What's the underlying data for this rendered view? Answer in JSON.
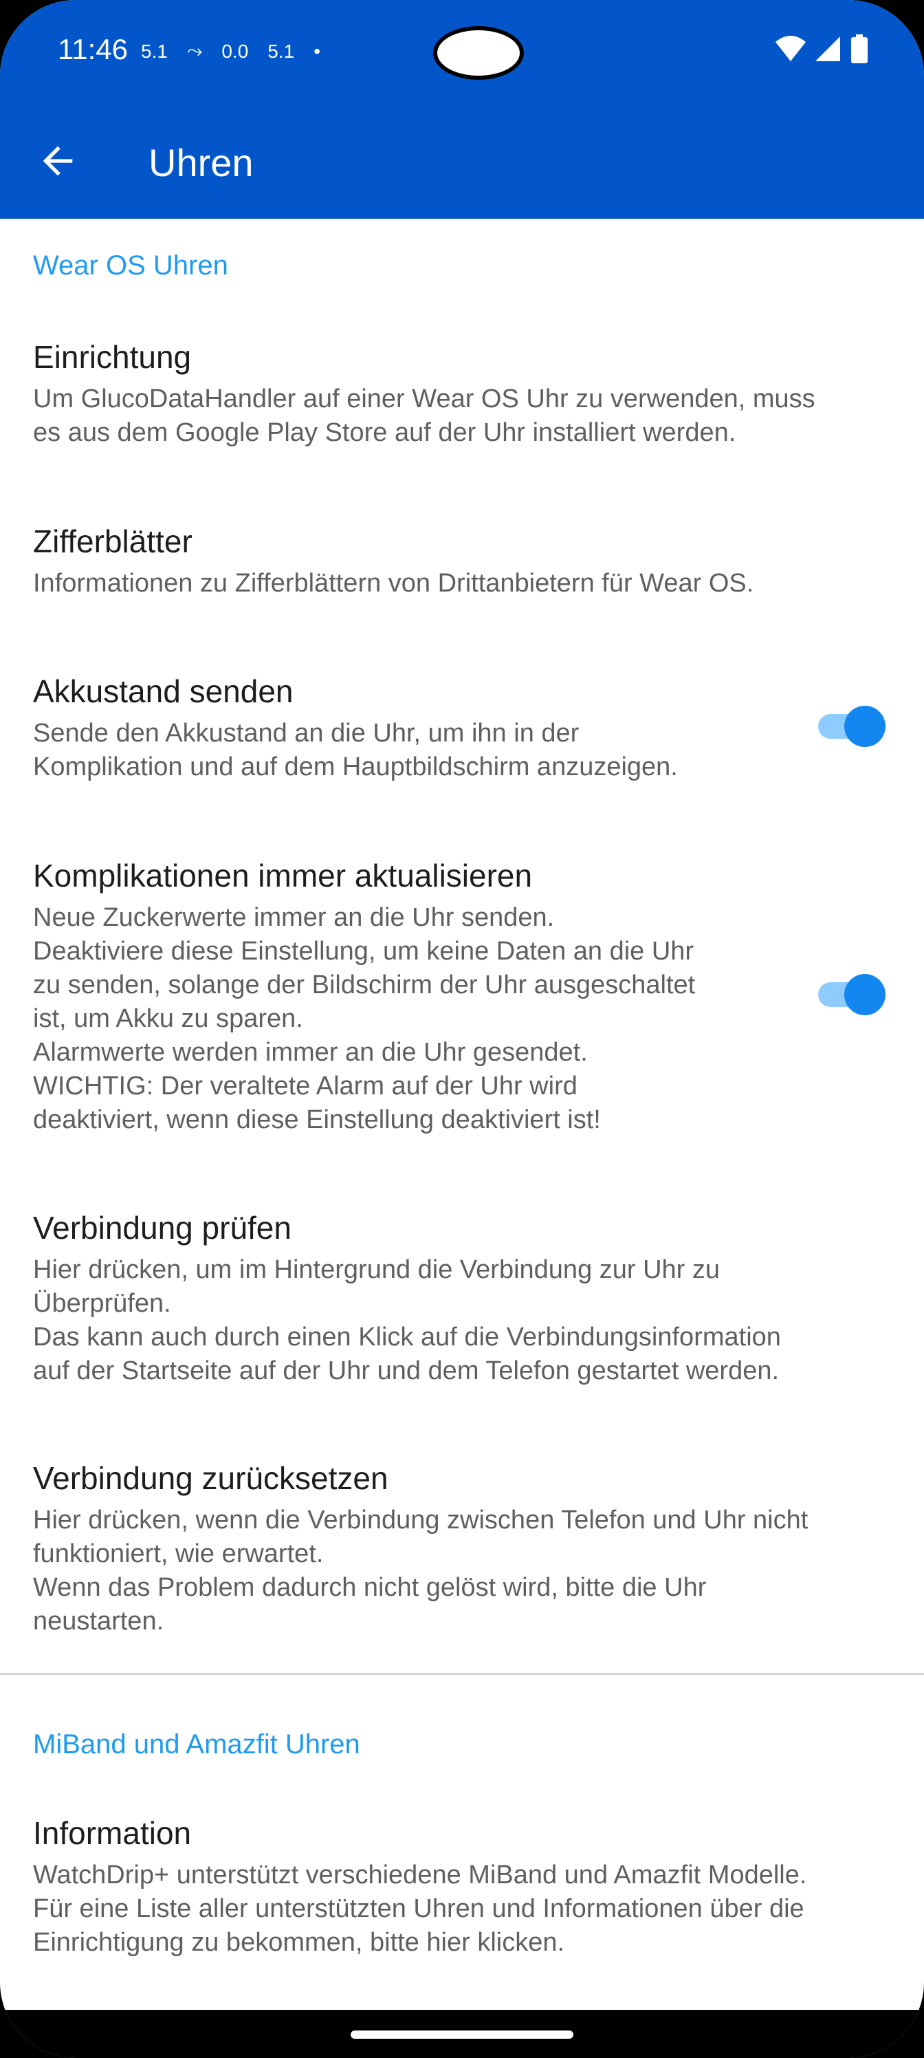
{
  "status_bar": {
    "time": "11:46",
    "indicators": [
      "5.1",
      "⤳",
      "0.0",
      "5.1",
      "•"
    ],
    "icons": [
      "wifi-icon",
      "signal-icon",
      "battery-icon"
    ]
  },
  "app_bar": {
    "title": "Uhren",
    "back_icon": "arrow-back-icon"
  },
  "sections": [
    {
      "header": "Wear OS Uhren",
      "items": [
        {
          "title": "Einrichtung",
          "summary": "Um GlucoDataHandler auf einer Wear OS Uhr zu verwenden, muss\nes aus dem Google Play Store auf der Uhr installiert werden."
        },
        {
          "title": "Zifferblätter",
          "summary": "Informationen zu Zifferblättern von Drittanbietern für Wear OS."
        },
        {
          "title": "Akkustand senden",
          "summary": "Sende den Akkustand an die Uhr, um ihn in der\nKomplikation und auf dem Hauptbildschirm anzuzeigen.",
          "toggle": true
        },
        {
          "title": "Komplikationen immer aktualisieren",
          "summary": "Neue Zuckerwerte immer an die Uhr senden.\nDeaktiviere diese Einstellung, um keine Daten an die Uhr\nzu senden, solange der Bildschirm der Uhr ausgeschaltet\nist, um Akku zu sparen.\nAlarmwerte werden immer an die Uhr gesendet.\nWICHTIG: Der veraltete Alarm auf der Uhr wird\ndeaktiviert, wenn diese Einstellung deaktiviert ist!",
          "toggle": true
        },
        {
          "title": "Verbindung prüfen",
          "summary": "Hier drücken, um im Hintergrund die Verbindung zur Uhr zu\nÜberprüfen.\nDas kann auch durch einen Klick auf die Verbindungsinformation\nauf der Startseite auf der Uhr und dem Telefon gestartet werden."
        },
        {
          "title": "Verbindung zurücksetzen",
          "summary": "Hier drücken, wenn die Verbindung zwischen Telefon und Uhr nicht\nfunktioniert, wie erwartet.\nWenn das Problem dadurch nicht gelöst wird, bitte die Uhr\nneustarten."
        }
      ]
    },
    {
      "header": "MiBand und Amazfit Uhren",
      "items": [
        {
          "title": "Information",
          "summary": "WatchDrip+ unterstützt verschiedene MiBand und Amazfit Modelle.\nFür eine Liste aller unterstützten Uhren und Informationen über die\nEinrichtigung zu bekommen, bitte hier klicken."
        }
      ]
    }
  ],
  "colors": {
    "app_bar": "#0356c9",
    "section_header": "#1e9bf0",
    "toggle_thumb": "#1486f0",
    "toggle_track": "#8ecbff"
  }
}
